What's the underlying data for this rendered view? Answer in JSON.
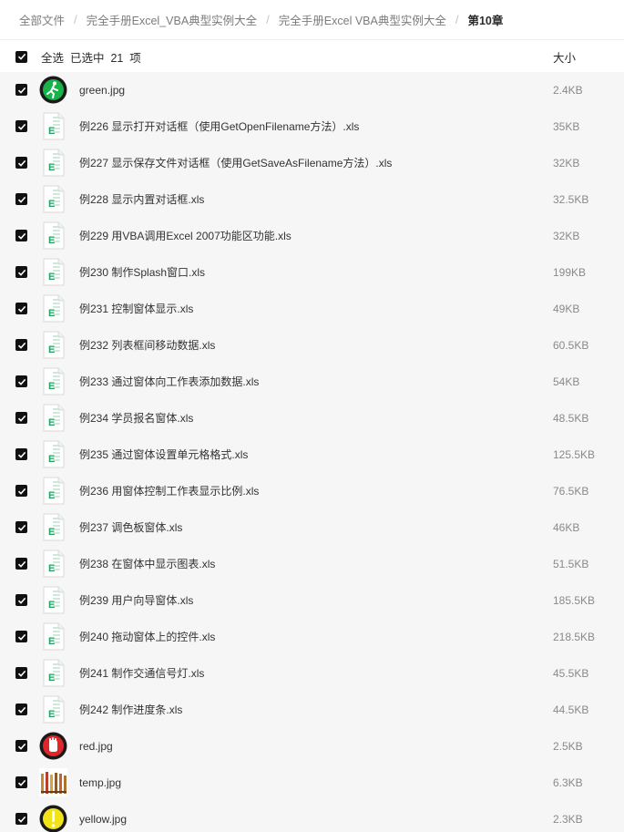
{
  "breadcrumb": {
    "items": [
      "全部文件",
      "完全手册Excel_VBA典型实例大全",
      "完全手册Excel VBA典型实例大全",
      "第10章"
    ]
  },
  "header": {
    "select_all": "全选",
    "selected_text": "已选中",
    "selected_count": "21",
    "selected_unit": "项",
    "size_label": "大小"
  },
  "files": [
    {
      "name": "green.jpg",
      "size": "2.4KB",
      "icon": "green-light-icon"
    },
    {
      "name": "例226 显示打开对话框（使用GetOpenFilename方法）.xls",
      "size": "35KB",
      "icon": "excel-file-icon"
    },
    {
      "name": "例227 显示保存文件对话框（使用GetSaveAsFilename方法）.xls",
      "size": "32KB",
      "icon": "excel-file-icon"
    },
    {
      "name": "例228 显示内置对话框.xls",
      "size": "32.5KB",
      "icon": "excel-file-icon"
    },
    {
      "name": "例229 用VBA调用Excel 2007功能区功能.xls",
      "size": "32KB",
      "icon": "excel-file-icon"
    },
    {
      "name": "例230 制作Splash窗口.xls",
      "size": "199KB",
      "icon": "excel-file-icon"
    },
    {
      "name": "例231 控制窗体显示.xls",
      "size": "49KB",
      "icon": "excel-file-icon"
    },
    {
      "name": "例232 列表框间移动数据.xls",
      "size": "60.5KB",
      "icon": "excel-file-icon"
    },
    {
      "name": "例233 通过窗体向工作表添加数据.xls",
      "size": "54KB",
      "icon": "excel-file-icon"
    },
    {
      "name": "例234 学员报名窗体.xls",
      "size": "48.5KB",
      "icon": "excel-file-icon"
    },
    {
      "name": "例235 通过窗体设置单元格格式.xls",
      "size": "125.5KB",
      "icon": "excel-file-icon"
    },
    {
      "name": "例236 用窗体控制工作表显示比例.xls",
      "size": "76.5KB",
      "icon": "excel-file-icon"
    },
    {
      "name": "例237 调色板窗体.xls",
      "size": "46KB",
      "icon": "excel-file-icon"
    },
    {
      "name": "例238 在窗体中显示图表.xls",
      "size": "51.5KB",
      "icon": "excel-file-icon"
    },
    {
      "name": "例239 用户向导窗体.xls",
      "size": "185.5KB",
      "icon": "excel-file-icon"
    },
    {
      "name": "例240 拖动窗体上的控件.xls",
      "size": "218.5KB",
      "icon": "excel-file-icon"
    },
    {
      "name": "例241 制作交通信号灯.xls",
      "size": "45.5KB",
      "icon": "excel-file-icon"
    },
    {
      "name": "例242 制作进度条.xls",
      "size": "44.5KB",
      "icon": "excel-file-icon"
    },
    {
      "name": "red.jpg",
      "size": "2.5KB",
      "icon": "red-light-icon"
    },
    {
      "name": "temp.jpg",
      "size": "6.3KB",
      "icon": "pencils-image-icon"
    },
    {
      "name": "yellow.jpg",
      "size": "2.3KB",
      "icon": "yellow-light-icon"
    }
  ],
  "colors": {
    "row_bg": "#f6f6f6",
    "excel_green": "#21a366",
    "checkbox": "#111111"
  }
}
